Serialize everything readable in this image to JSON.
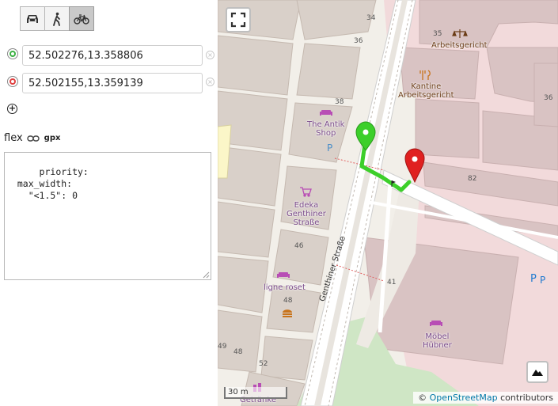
{
  "vehicles": [
    {
      "name": "car",
      "icon": "car-icon",
      "active": false
    },
    {
      "name": "foot",
      "icon": "walker-icon",
      "active": false
    },
    {
      "name": "bike",
      "icon": "bicycle-icon",
      "active": true
    }
  ],
  "points": {
    "start": {
      "value": "52.502276,13.358806",
      "color": "#3cb043"
    },
    "end": {
      "value": "52.502155,13.359139",
      "color": "#e04040"
    }
  },
  "profile": {
    "name": "flex",
    "gpx_label": "gpx"
  },
  "editor": {
    "text": "priority:\n  max_width:\n    \"<1.5\": 0"
  },
  "map": {
    "scale_label": "30 m",
    "attribution_prefix": "©",
    "attribution_link": "OpenStreetMap",
    "attribution_suffix": "contributors",
    "street_name": "Genthiner Straße",
    "pois": [
      {
        "label": "Arbeitsgericht",
        "icon": "scales-icon"
      },
      {
        "label": "Kantine\nArbeitsgericht",
        "icon": "restaurant-icon"
      },
      {
        "label": "The Antik\nShop",
        "icon": "sofa-icon"
      },
      {
        "label": "Edeka\nGenthiner\nStraße",
        "icon": "cart-icon"
      },
      {
        "label": "ligne roset",
        "icon": "sofa-icon"
      },
      {
        "label": "Möbel\nHübner",
        "icon": "sofa-icon"
      },
      {
        "label": "Getränke",
        "icon": "bottles-icon"
      }
    ],
    "house_numbers": [
      "34",
      "36",
      "35",
      "36",
      "38",
      "82",
      "46",
      "48",
      "49",
      "48",
      "52",
      "41"
    ],
    "route_color": "#3ccf2a",
    "parking_label": "P"
  }
}
